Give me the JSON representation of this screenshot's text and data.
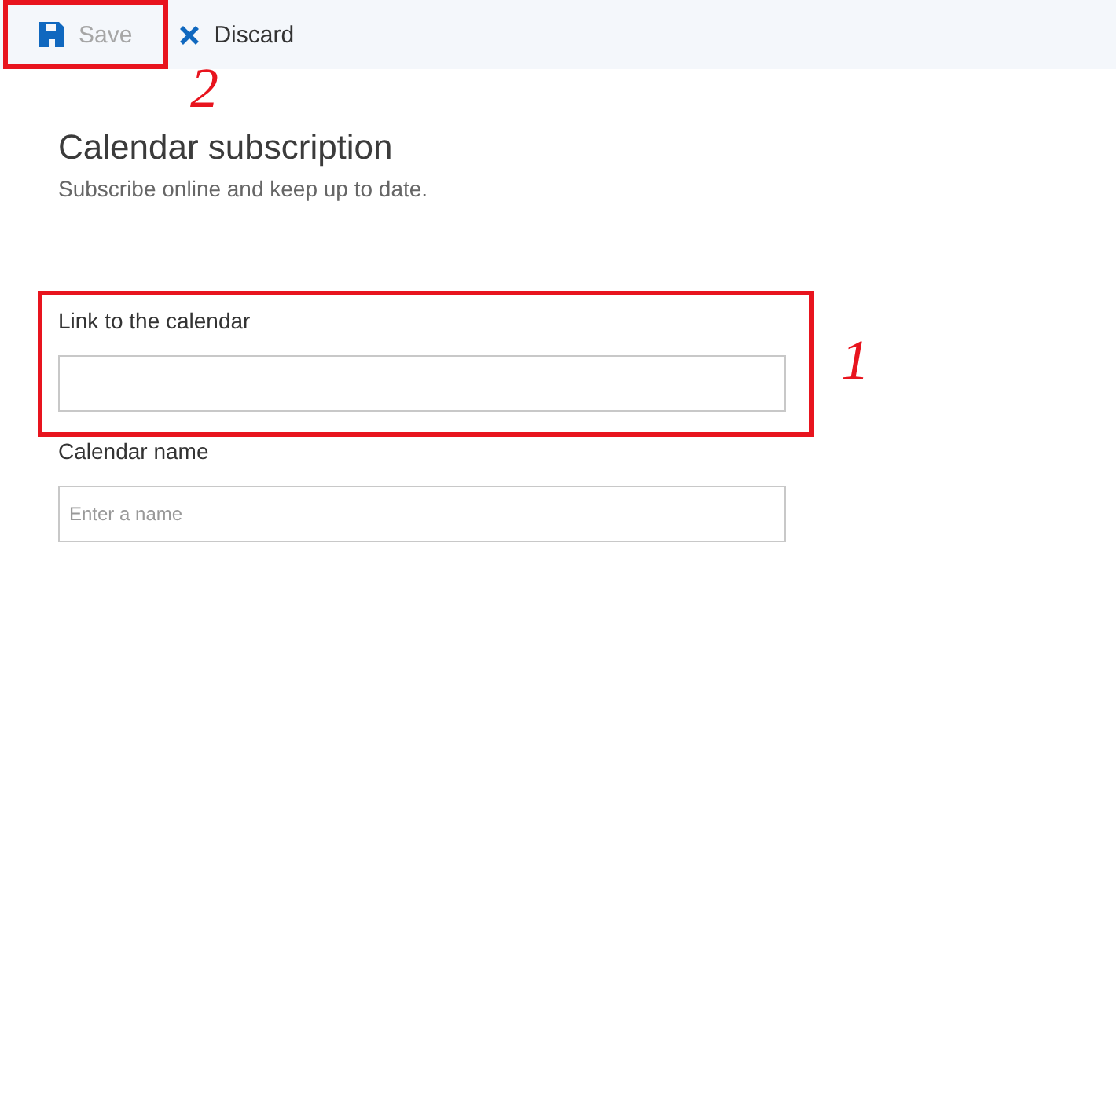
{
  "toolbar": {
    "buttons": [
      {
        "kind": "save",
        "label": "Save",
        "disabled": true,
        "annotation": "2"
      },
      {
        "kind": "discard",
        "label": "Discard",
        "disabled": false
      }
    ]
  },
  "header": {
    "title": "Calendar subscription",
    "subtitle": "Subscribe online and keep up to date."
  },
  "fields": [
    {
      "label": "Link to the calendar",
      "annotation": "1"
    },
    {
      "label": "Calendar name",
      "placeholder": "Enter a name"
    }
  ]
}
